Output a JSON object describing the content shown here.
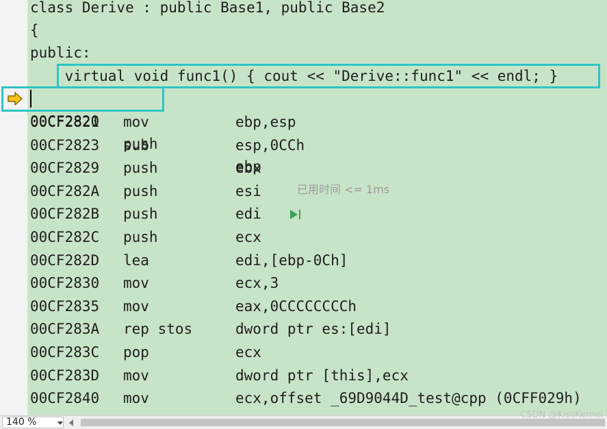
{
  "source_lines": [
    "class Derive : public Base1, public Base2",
    "{",
    "public:",
    "    virtual void func1() { cout << \"Derive::func1\" << endl; }"
  ],
  "current_instruction": {
    "address": "00CF2820",
    "mnemonic": "push",
    "operand": "ebp",
    "elapsed": "已用时间 <= 1ms"
  },
  "instructions": [
    {
      "address": "00CF2821",
      "mnemonic": "mov",
      "operand": "ebp,esp"
    },
    {
      "address": "00CF2823",
      "mnemonic": "sub",
      "operand": "esp,0CCh"
    },
    {
      "address": "00CF2829",
      "mnemonic": "push",
      "operand": "ebx"
    },
    {
      "address": "00CF282A",
      "mnemonic": "push",
      "operand": "esi"
    },
    {
      "address": "00CF282B",
      "mnemonic": "push",
      "operand": "edi"
    },
    {
      "address": "00CF282C",
      "mnemonic": "push",
      "operand": "ecx"
    },
    {
      "address": "00CF282D",
      "mnemonic": "lea",
      "operand": "edi,[ebp-0Ch]"
    },
    {
      "address": "00CF2830",
      "mnemonic": "mov",
      "operand": "ecx,3"
    },
    {
      "address": "00CF2835",
      "mnemonic": "mov",
      "operand": "eax,0CCCCCCCCh"
    },
    {
      "address": "00CF283A",
      "mnemonic": "rep stos",
      "operand": "dword ptr es:[edi]"
    },
    {
      "address": "00CF283C",
      "mnemonic": "pop",
      "operand": "ecx"
    },
    {
      "address": "00CF283D",
      "mnemonic": "mov",
      "operand": "dword ptr [this],ecx"
    },
    {
      "address": "00CF2840",
      "mnemonic": "mov",
      "operand": "ecx,offset _69D9044D_test@cpp (0CFF029h)"
    }
  ],
  "run_to_click_icon": "run-to-cursor-icon",
  "current_line_icon": "instruction-pointer-arrow-icon",
  "highlight_color": "#2ec4c4",
  "statusbar": {
    "zoom": "140 %"
  },
  "watermark": "CSDN @KissKernel"
}
